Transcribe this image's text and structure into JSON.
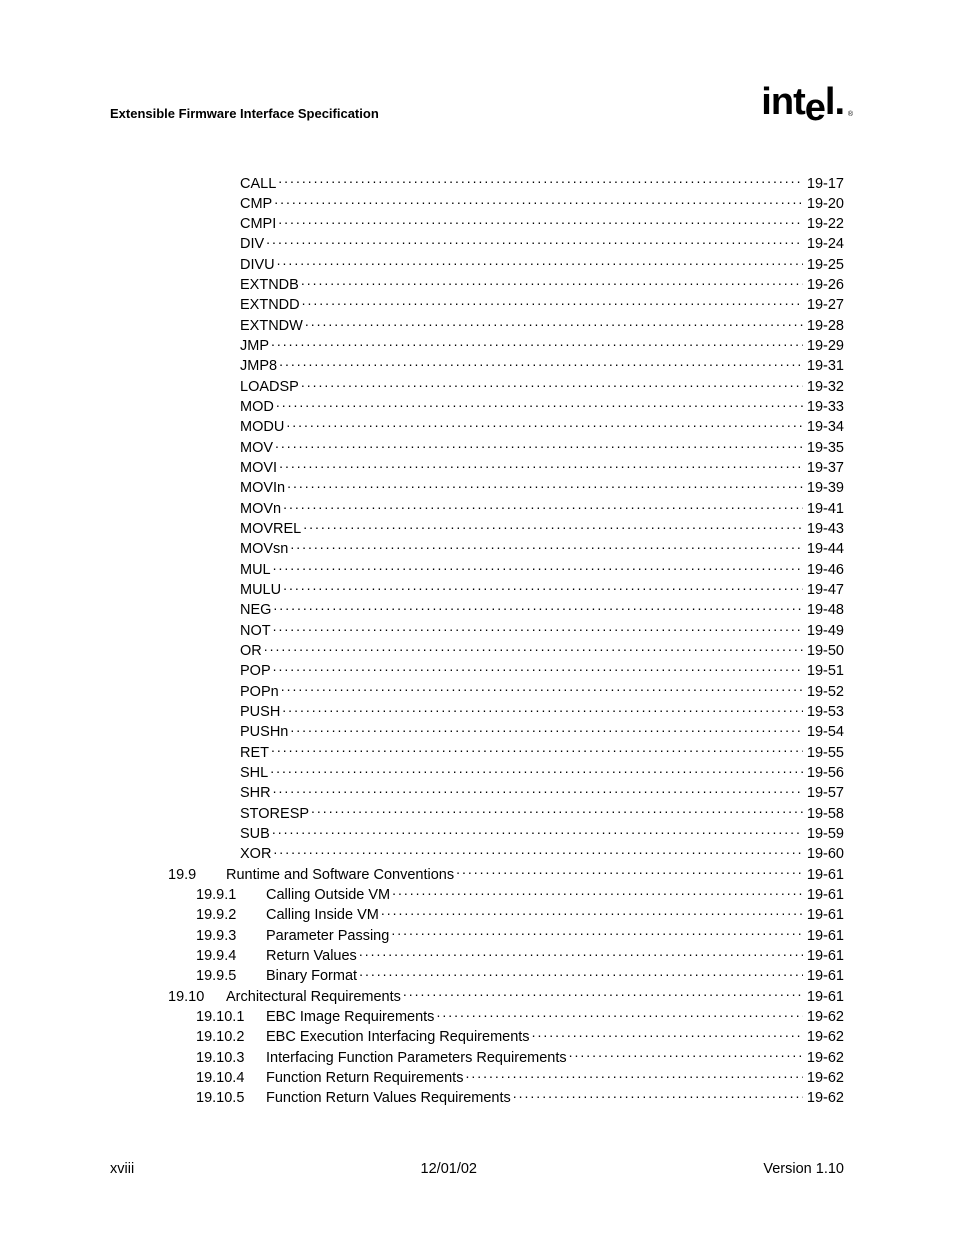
{
  "header": {
    "title": "Extensible Firmware Interface Specification",
    "logo": "intel"
  },
  "toc": {
    "entries": [
      {
        "level": 2,
        "num": "",
        "label": "CALL",
        "page": "19-17"
      },
      {
        "level": 2,
        "num": "",
        "label": "CMP",
        "page": "19-20"
      },
      {
        "level": 2,
        "num": "",
        "label": "CMPI",
        "page": "19-22"
      },
      {
        "level": 2,
        "num": "",
        "label": "DIV",
        "page": "19-24"
      },
      {
        "level": 2,
        "num": "",
        "label": "DIVU",
        "page": "19-25"
      },
      {
        "level": 2,
        "num": "",
        "label": "EXTNDB",
        "page": "19-26"
      },
      {
        "level": 2,
        "num": "",
        "label": "EXTNDD",
        "page": "19-27"
      },
      {
        "level": 2,
        "num": "",
        "label": "EXTNDW",
        "page": "19-28"
      },
      {
        "level": 2,
        "num": "",
        "label": "JMP",
        "page": "19-29"
      },
      {
        "level": 2,
        "num": "",
        "label": "JMP8",
        "page": "19-31"
      },
      {
        "level": 2,
        "num": "",
        "label": "LOADSP",
        "page": "19-32"
      },
      {
        "level": 2,
        "num": "",
        "label": "MOD",
        "page": "19-33"
      },
      {
        "level": 2,
        "num": "",
        "label": "MODU",
        "page": "19-34"
      },
      {
        "level": 2,
        "num": "",
        "label": "MOV",
        "page": "19-35"
      },
      {
        "level": 2,
        "num": "",
        "label": "MOVI",
        "page": "19-37"
      },
      {
        "level": 2,
        "num": "",
        "label": "MOVIn",
        "page": "19-39"
      },
      {
        "level": 2,
        "num": "",
        "label": "MOVn",
        "page": "19-41"
      },
      {
        "level": 2,
        "num": "",
        "label": "MOVREL",
        "page": "19-43"
      },
      {
        "level": 2,
        "num": "",
        "label": "MOVsn",
        "page": "19-44"
      },
      {
        "level": 2,
        "num": "",
        "label": "MUL",
        "page": "19-46"
      },
      {
        "level": 2,
        "num": "",
        "label": "MULU",
        "page": "19-47"
      },
      {
        "level": 2,
        "num": "",
        "label": "NEG",
        "page": "19-48"
      },
      {
        "level": 2,
        "num": "",
        "label": "NOT",
        "page": "19-49"
      },
      {
        "level": 2,
        "num": "",
        "label": "OR",
        "page": "19-50"
      },
      {
        "level": 2,
        "num": "",
        "label": "POP",
        "page": "19-51"
      },
      {
        "level": 2,
        "num": "",
        "label": "POPn",
        "page": "19-52"
      },
      {
        "level": 2,
        "num": "",
        "label": "PUSH",
        "page": "19-53"
      },
      {
        "level": 2,
        "num": "",
        "label": "PUSHn",
        "page": "19-54"
      },
      {
        "level": 2,
        "num": "",
        "label": "RET",
        "page": "19-55"
      },
      {
        "level": 2,
        "num": "",
        "label": "SHL",
        "page": "19-56"
      },
      {
        "level": 2,
        "num": "",
        "label": "SHR",
        "page": "19-57"
      },
      {
        "level": 2,
        "num": "",
        "label": "STORESP",
        "page": "19-58"
      },
      {
        "level": 2,
        "num": "",
        "label": "SUB",
        "page": "19-59"
      },
      {
        "level": 2,
        "num": "",
        "label": "XOR",
        "page": "19-60"
      },
      {
        "level": 0,
        "num": "19.9",
        "label": "Runtime and Software Conventions",
        "page": "19-61"
      },
      {
        "level": 1,
        "num": "19.9.1",
        "label": "Calling Outside VM",
        "page": "19-61"
      },
      {
        "level": 1,
        "num": "19.9.2",
        "label": "Calling Inside VM",
        "page": "19-61"
      },
      {
        "level": 1,
        "num": "19.9.3",
        "label": "Parameter Passing",
        "page": "19-61"
      },
      {
        "level": 1,
        "num": "19.9.4",
        "label": "Return Values",
        "page": "19-61"
      },
      {
        "level": 1,
        "num": "19.9.5",
        "label": "Binary Format",
        "page": "19-61"
      },
      {
        "level": 0,
        "num": "19.10",
        "label": "Architectural Requirements",
        "page": "19-61"
      },
      {
        "level": 1,
        "num": "19.10.1",
        "label": "EBC Image Requirements",
        "page": "19-62"
      },
      {
        "level": 1,
        "num": "19.10.2",
        "label": "EBC Execution Interfacing Requirements",
        "page": "19-62"
      },
      {
        "level": 1,
        "num": "19.10.3",
        "label": "Interfacing Function Parameters Requirements",
        "page": "19-62"
      },
      {
        "level": 1,
        "num": "19.10.4",
        "label": "Function Return Requirements",
        "page": "19-62"
      },
      {
        "level": 1,
        "num": "19.10.5",
        "label": "Function Return Values Requirements",
        "page": "19-62"
      }
    ]
  },
  "footer": {
    "left": "xviii",
    "center": "12/01/02",
    "right": "Version 1.10"
  }
}
